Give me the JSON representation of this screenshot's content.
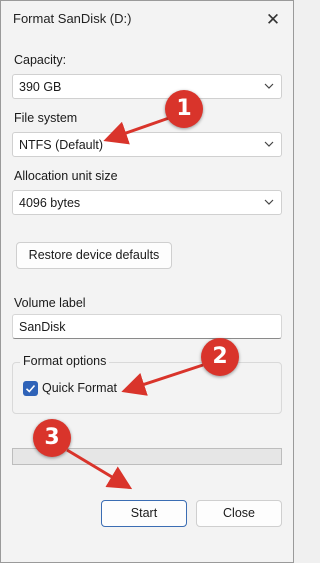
{
  "window": {
    "title": "Format SanDisk (D:)",
    "close_glyph": "✕"
  },
  "capacity": {
    "label": "Capacity:",
    "value": "390 GB"
  },
  "filesystem": {
    "label": "File system",
    "value": "NTFS (Default)"
  },
  "allocation": {
    "label": "Allocation unit size",
    "value": "4096 bytes"
  },
  "restore_button": "Restore device defaults",
  "volume": {
    "label": "Volume label",
    "value": "SanDisk"
  },
  "format_options": {
    "legend": "Format options",
    "quick_format": {
      "label": "Quick Format",
      "checked": true
    }
  },
  "progress": {
    "value": 0
  },
  "buttons": {
    "start": "Start",
    "close": "Close"
  },
  "annotations": [
    {
      "number": "1"
    },
    {
      "number": "2"
    },
    {
      "number": "3"
    }
  ],
  "colors": {
    "accent": "#2f63b8",
    "annotation": "#d9342b"
  },
  "icons": {
    "close": "close-icon",
    "chevron": "chevron-down-icon",
    "check": "check-icon"
  }
}
